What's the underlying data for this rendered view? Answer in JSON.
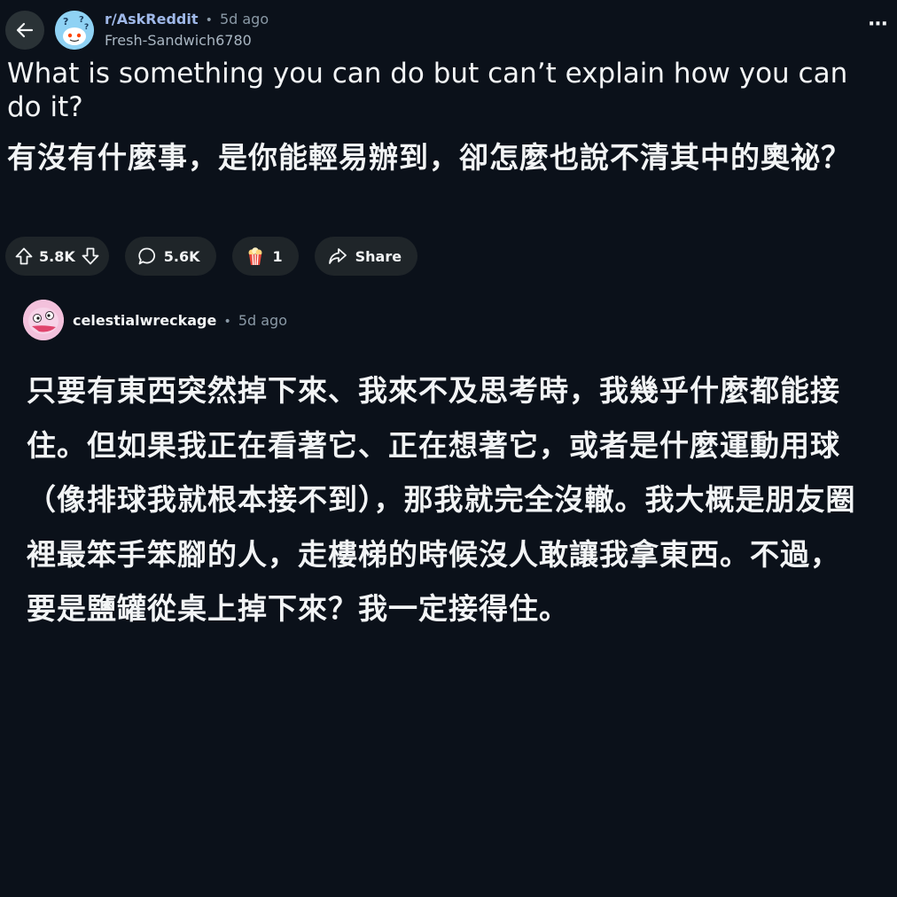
{
  "header": {
    "subreddit": "r/AskReddit",
    "separator": "•",
    "age": "5d ago",
    "author": "Fresh-Sandwich6780",
    "more_label": "···"
  },
  "post": {
    "title": "What is something you can do but can’t explain how you can do it?",
    "title_zh": "有沒有什麼事，是你能輕易辦到，卻怎麼也說不清其中的奧祕？",
    "votes": "5.8K",
    "comments": "5.6K",
    "awards": "1",
    "share_label": "Share"
  },
  "comment": {
    "author": "celestialwreckage",
    "separator": "•",
    "age": "5d ago",
    "body": "只要有東西突然掉下來、我來不及思考時，我幾乎什麼都能接住。但如果我正在看著它、正在想著它，或者是什麼運動用球（像排球我就根本接不到），那我就完全沒轍。我大概是朋友圈裡最笨手笨腳的人，走樓梯的時候沒人敢讓我拿東西。不過，要是鹽罐從桌上掉下來？我一定接得住。"
  },
  "colors": {
    "background": "#0b111a",
    "pill": "#1f2529",
    "subreddit_link": "#9fb8e8",
    "muted": "#8a99a6"
  },
  "icons": {
    "back": "arrow-left-icon",
    "upvote": "upvote-arrow-icon",
    "downvote": "downvote-arrow-icon",
    "comment": "speech-bubble-icon",
    "award": "popcorn-award-icon",
    "share": "share-arrow-icon",
    "more": "more-dots-icon"
  }
}
